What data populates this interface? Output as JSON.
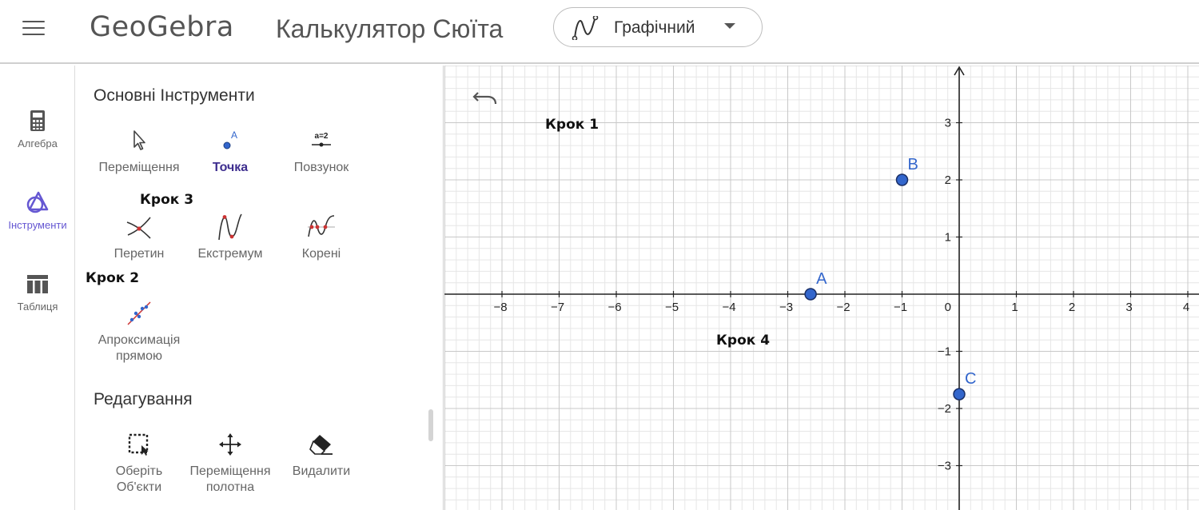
{
  "header": {
    "logo": "GeoGebra",
    "title": "Калькулятор Сюїта",
    "mode_label": "Графічний"
  },
  "nav": {
    "items": [
      {
        "label": "Алгебра",
        "icon": "calculator-icon"
      },
      {
        "label": "Інструменти",
        "icon": "tools-icon",
        "active": true
      },
      {
        "label": "Таблиця",
        "icon": "table-icon"
      }
    ]
  },
  "tools": {
    "basic_title": "Основні Інструменти",
    "edit_title": "Редагування",
    "basic": [
      {
        "label": "Переміщення",
        "icon": "cursor-arrow-icon"
      },
      {
        "label": "Точка",
        "icon": "point-icon",
        "selected": true
      },
      {
        "label": "Повзунок",
        "icon": "slider-icon",
        "icon_text": "a=2"
      },
      {
        "label": "Перетин",
        "icon": "intersect-icon"
      },
      {
        "label": "Екстремум",
        "icon": "extremum-icon"
      },
      {
        "label": "Корені",
        "icon": "roots-icon"
      },
      {
        "label": "Апроксимація прямою",
        "icon": "best-fit-line-icon"
      }
    ],
    "edit": [
      {
        "label": "Оберіть Об'єкти",
        "icon": "select-objects-icon"
      },
      {
        "label": "Переміщення полотна",
        "icon": "move-canvas-icon"
      },
      {
        "label": "Видалити",
        "icon": "eraser-icon"
      }
    ]
  },
  "steps": {
    "step1": "Крок 1",
    "step2": "Крок 2",
    "step3": "Крок 3",
    "step4": "Крок 4"
  },
  "graph": {
    "x_range": [
      -8.9,
      4.3
    ],
    "y_range": [
      -3.8,
      4.0
    ],
    "x_ticks": [
      -8,
      -7,
      -6,
      -5,
      -4,
      -3,
      -2,
      -1,
      1,
      2,
      3,
      4
    ],
    "y_ticks": [
      -3,
      -2,
      -1,
      1,
      2,
      3
    ],
    "origin_label": "0",
    "point_color": "#3366cc",
    "points": [
      {
        "name": "A",
        "x": -2.6,
        "y": 0
      },
      {
        "name": "B",
        "x": -1,
        "y": 2
      },
      {
        "name": "C",
        "x": 0,
        "y": -1.75
      }
    ]
  },
  "colors": {
    "accent": "#6557d2",
    "grid_minor": "#e6e6e6",
    "grid_major": "#c8c8c8",
    "axis": "#222222"
  }
}
